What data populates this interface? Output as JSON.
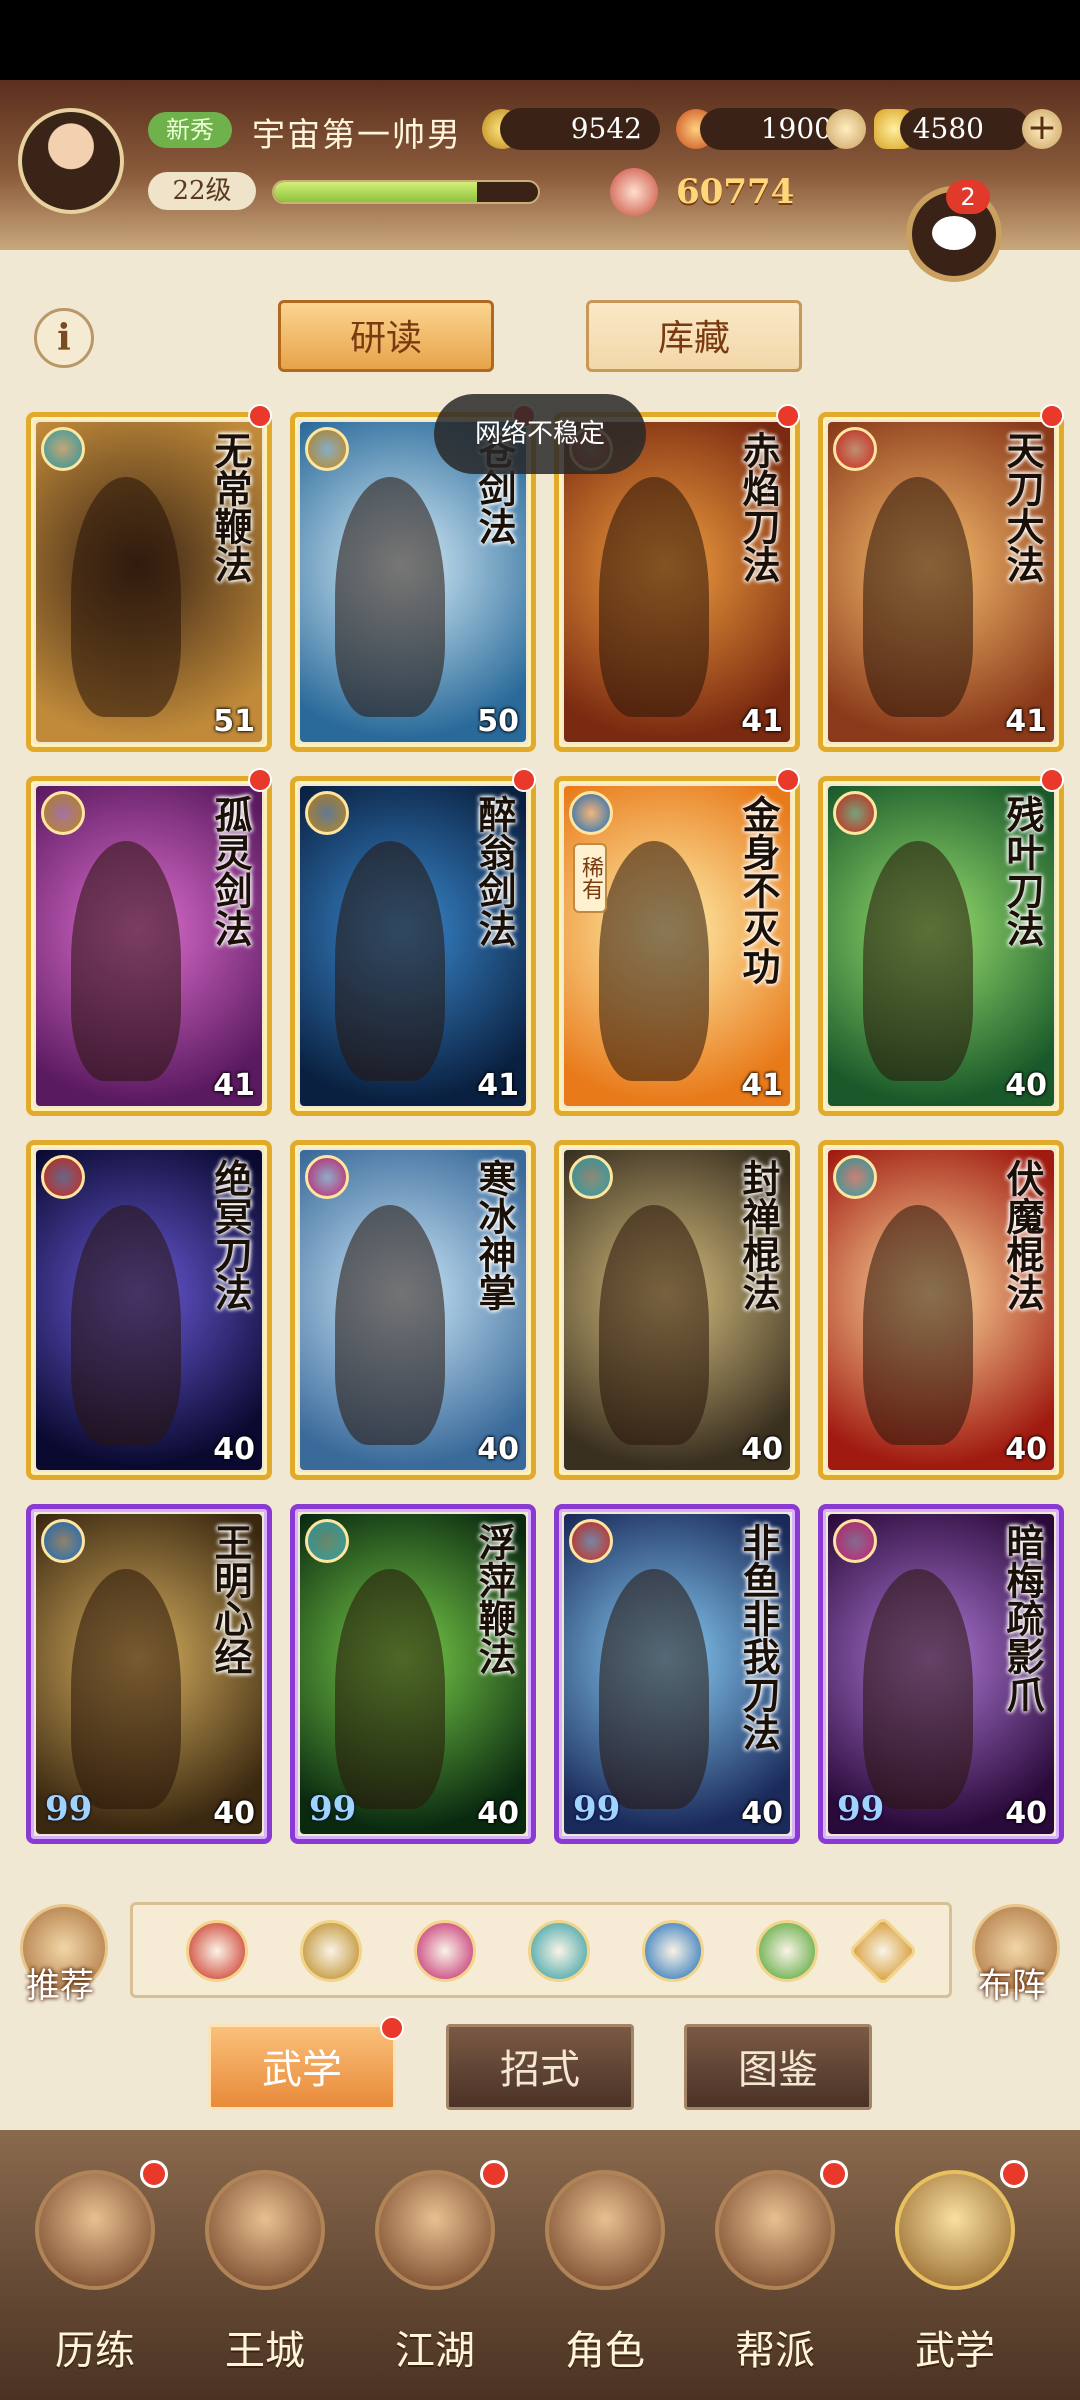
{
  "player": {
    "badge": "新秀",
    "name": "宇宙第一帅男",
    "level": "22级",
    "xp_fraction": 0.77
  },
  "resources": {
    "coins": "9542",
    "stamina": "1900",
    "gold": "4580",
    "power": "60774"
  },
  "chat": {
    "unread": "2"
  },
  "tabs": {
    "study": "研读",
    "storage": "库藏"
  },
  "toast": "网络不稳定",
  "cards": [
    {
      "title": "无常鞭法",
      "level": "51",
      "icon_color": "#2a9aa0",
      "colors": [
        "#3a2414",
        "#c08a3a"
      ],
      "frame": "gold"
    },
    {
      "title": "苍剑法",
      "level": "50",
      "icon_color": "#b8841a",
      "colors": [
        "#d8eef8",
        "#2a6a9a"
      ],
      "frame": "gold"
    },
    {
      "title": "赤焰刀法",
      "level": "41",
      "icon_color": "#c8281a",
      "colors": [
        "#f2a040",
        "#7a2a10"
      ],
      "frame": "gold"
    },
    {
      "title": "天刀大法",
      "level": "41",
      "icon_color": "#c8281a",
      "colors": [
        "#f8c070",
        "#8a3a1a"
      ],
      "frame": "gold"
    },
    {
      "title": "孤灵剑法",
      "level": "41",
      "icon_color": "#b8841a",
      "colors": [
        "#e070d0",
        "#5a1a60"
      ],
      "frame": "gold"
    },
    {
      "title": "醉翁剑法",
      "level": "41",
      "icon_color": "#b8841a",
      "colors": [
        "#3a8ad0",
        "#0a2040"
      ],
      "frame": "gold"
    },
    {
      "title": "金身不灭功",
      "level": "41",
      "icon_color": "#1a6ab8",
      "colors": [
        "#fff2b0",
        "#e87a1a"
      ],
      "frame": "gold",
      "rare": "稀有"
    },
    {
      "title": "残叶刀法",
      "level": "40",
      "icon_color": "#c8281a",
      "colors": [
        "#9ae070",
        "#1a5a2a"
      ],
      "frame": "gold"
    },
    {
      "title": "绝冥刀法",
      "level": "40",
      "icon_color": "#c8281a",
      "colors": [
        "#6a5ad8",
        "#0a0a30"
      ],
      "frame": "gold"
    },
    {
      "title": "寒冰神掌",
      "level": "40",
      "icon_color": "#c0206a",
      "colors": [
        "#cde8f8",
        "#3a6a9a"
      ],
      "frame": "gold"
    },
    {
      "title": "封禅棍法",
      "level": "40",
      "icon_color": "#2a9aa0",
      "colors": [
        "#d8c080",
        "#3a3020"
      ],
      "frame": "gold"
    },
    {
      "title": "伏魔棍法",
      "level": "40",
      "icon_color": "#2a9aa0",
      "colors": [
        "#ffe0a0",
        "#a01a10"
      ],
      "frame": "gold"
    },
    {
      "title": "王明心经",
      "level": "40",
      "icon_color": "#1a6ab8",
      "colors": [
        "#d8b060",
        "#3a2810"
      ],
      "frame": "purple",
      "quality": "99"
    },
    {
      "title": "浮萍鞭法",
      "level": "40",
      "icon_color": "#2a9aa0",
      "colors": [
        "#7ad04a",
        "#0a2a10"
      ],
      "frame": "purple",
      "quality": "99"
    },
    {
      "title": "非鱼非我刀法",
      "level": "40",
      "icon_color": "#c8281a",
      "colors": [
        "#8ad0f8",
        "#1a2a5a"
      ],
      "frame": "purple",
      "quality": "99"
    },
    {
      "title": "暗梅疏影爪",
      "level": "40",
      "icon_color": "#c0206a",
      "colors": [
        "#b07ad8",
        "#2a0a3a"
      ],
      "frame": "purple",
      "quality": "99"
    }
  ],
  "filter": {
    "recommend": "推荐",
    "formation": "布阵",
    "icons": [
      {
        "name": "saber-filter-icon",
        "color": "#c8281a"
      },
      {
        "name": "sword-filter-icon",
        "color": "#b8841a"
      },
      {
        "name": "palm-filter-icon",
        "color": "#c0206a"
      },
      {
        "name": "whip-filter-icon",
        "color": "#2a9aa0"
      },
      {
        "name": "inner-force-filter-icon",
        "color": "#1a6ab8"
      },
      {
        "name": "light-skill-filter-icon",
        "color": "#4aa02a"
      },
      {
        "name": "other-filter-icon",
        "color": "#d8a040"
      }
    ]
  },
  "sub_tabs": {
    "martial": "武学",
    "moves": "招式",
    "atlas": "图鉴"
  },
  "nav": [
    {
      "label": "历练",
      "dot": true
    },
    {
      "label": "王城",
      "dot": false
    },
    {
      "label": "江湖",
      "dot": true
    },
    {
      "label": "角色",
      "dot": false
    },
    {
      "label": "帮派",
      "dot": true
    },
    {
      "label": "武学",
      "dot": true
    }
  ]
}
